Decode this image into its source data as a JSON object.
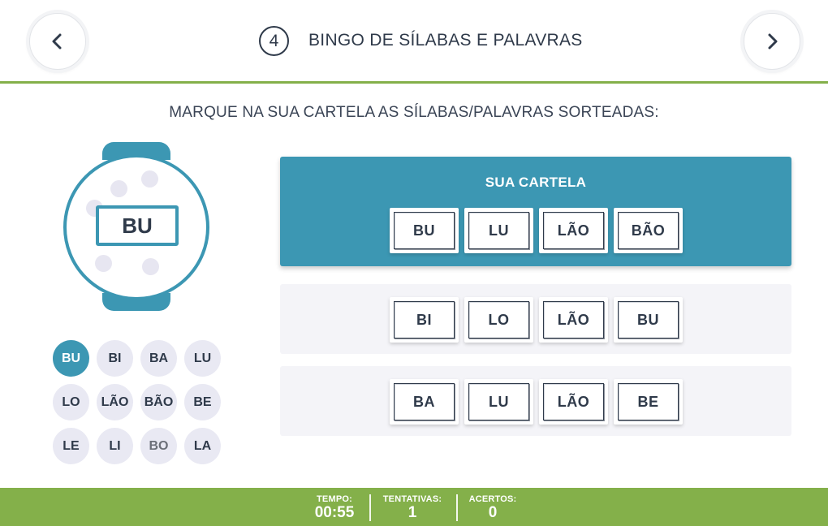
{
  "header": {
    "step_number": "4",
    "title": "BINGO DE SÍLABAS E PALAVRAS",
    "prev_icon": "chevron-left-icon",
    "next_icon": "chevron-right-icon"
  },
  "instruction": "MARQUE NA SUA CARTELA AS SÍLABAS/PALAVRAS SORTEADAS:",
  "cage": {
    "current_draw": "BU"
  },
  "drawn": [
    {
      "label": "BU",
      "state": "active"
    },
    {
      "label": "BI",
      "state": "normal"
    },
    {
      "label": "BA",
      "state": "normal"
    },
    {
      "label": "LU",
      "state": "normal"
    },
    {
      "label": "LO",
      "state": "normal"
    },
    {
      "label": "LÃO",
      "state": "normal"
    },
    {
      "label": "BÃO",
      "state": "normal"
    },
    {
      "label": "BE",
      "state": "normal"
    },
    {
      "label": "LE",
      "state": "normal"
    },
    {
      "label": "LI",
      "state": "normal"
    },
    {
      "label": "BO",
      "state": "faded"
    },
    {
      "label": "LA",
      "state": "normal"
    }
  ],
  "cards": {
    "mine": {
      "title": "SUA CARTELA",
      "tiles": [
        "BU",
        "LU",
        "LÃO",
        "BÃO"
      ]
    },
    "card2": {
      "tiles": [
        "BI",
        "LO",
        "LÃO",
        "BU"
      ]
    },
    "card3": {
      "tiles": [
        "BA",
        "LU",
        "LÃO",
        "BE"
      ]
    }
  },
  "footer": {
    "time_label": "TEMPO:",
    "time_value": "00:55",
    "attempts_label": "TENTATIVAS:",
    "attempts_value": "1",
    "hits_label": "ACERTOS:",
    "hits_value": "0"
  },
  "colors": {
    "accent": "#3c97b3",
    "footer": "#84b04a",
    "chip": "#e9e9f3",
    "text": "#2f3a4a"
  }
}
